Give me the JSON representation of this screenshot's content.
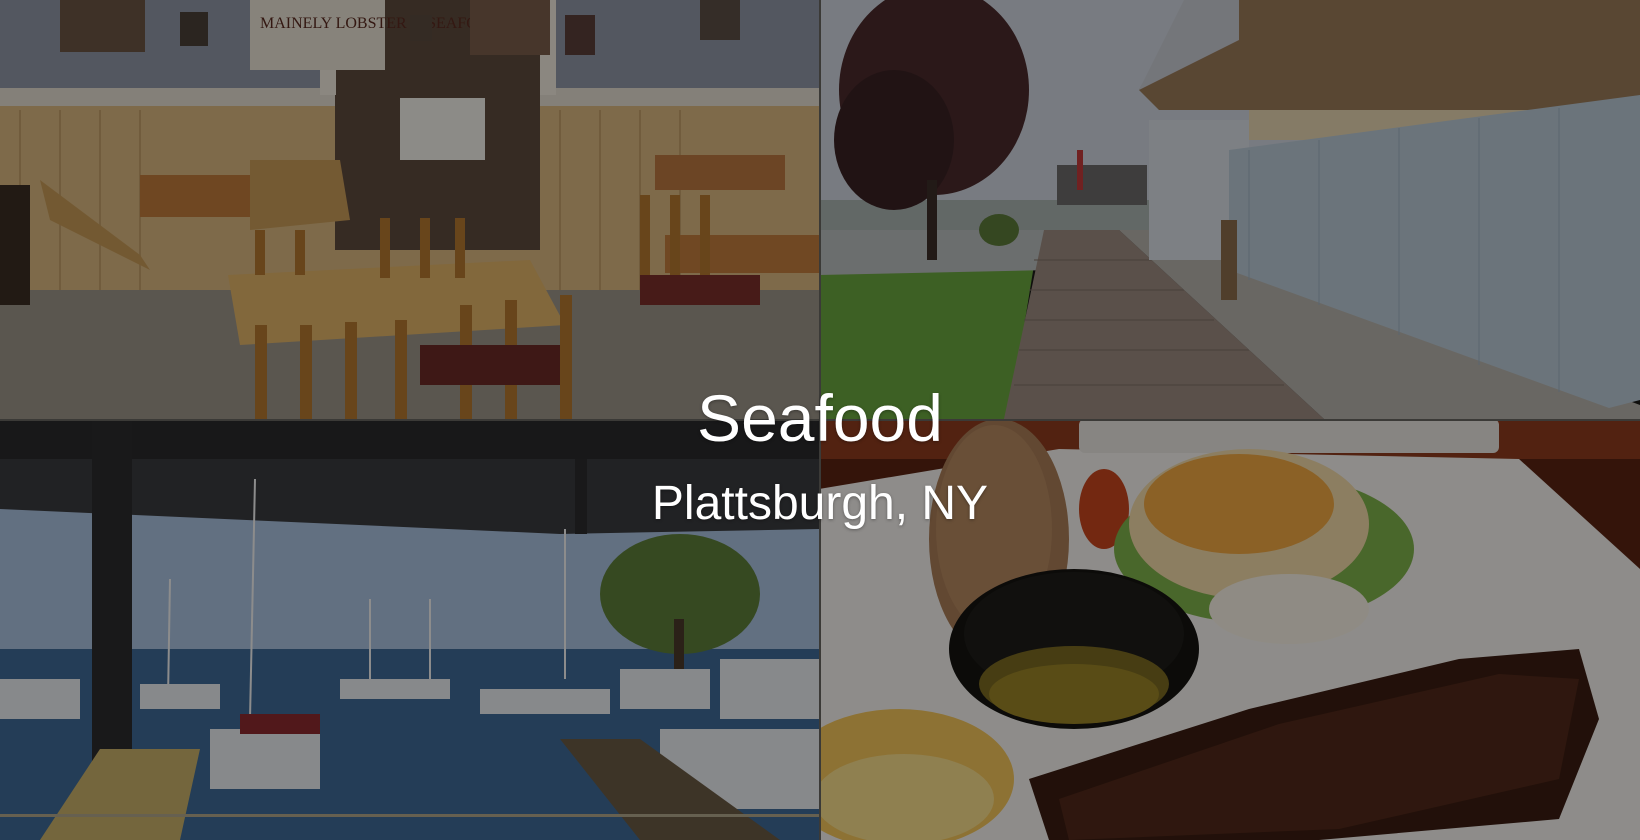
{
  "hero": {
    "title": "Seafood",
    "subtitle": "Plattsburgh, NY"
  },
  "photos": [
    {
      "id": "dining-room",
      "sign_text": "MAINELY LOBSTER & SEAFOOD"
    },
    {
      "id": "waterfront-walkway"
    },
    {
      "id": "marina-view"
    },
    {
      "id": "steak-and-lobster-plate"
    }
  ]
}
